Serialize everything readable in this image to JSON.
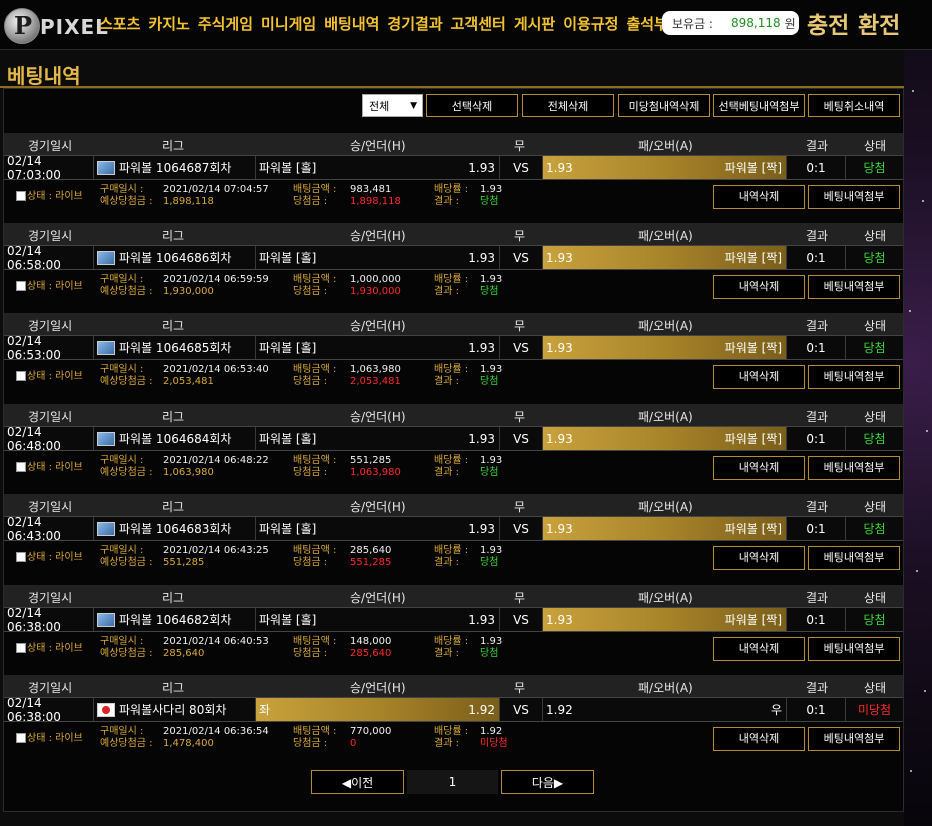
{
  "header": {
    "logo": "PIXEL",
    "logo_letter": "P",
    "nav": [
      "스포츠",
      "카지노",
      "주식게임",
      "미니게임",
      "배팅내역",
      "경기결과",
      "고객센터",
      "게시판",
      "이용규정",
      "출석부"
    ],
    "balance_label": "보유금 :",
    "balance_value": "898,118",
    "balance_unit": "원",
    "charge": "충전",
    "exchange": "환전"
  },
  "page_title": "베팅내역",
  "toolbar": {
    "filter_value": "전체",
    "buttons": [
      "선택삭제",
      "전체삭제",
      "미당첨내역삭제",
      "선택베팅내역첨부",
      "베팅취소내역"
    ]
  },
  "columns": {
    "date": "경기일시",
    "league": "리그",
    "home": "승/언더(H)",
    "draw": "무",
    "away": "패/오버(A)",
    "result": "결과",
    "status": "상태"
  },
  "labels": {
    "state": "상태 : 라이브",
    "purchase_time": "구매일시 :",
    "expected_win": "예상당첨금 :",
    "bet_amount": "배팅금액 :",
    "win_amount": "당첨금 :",
    "odds": "배당률 :",
    "result": "결과 :",
    "delete": "내역삭제",
    "attach": "베팅내역첨부",
    "vs": "VS"
  },
  "bets": [
    {
      "date": "02/14 07:03:00",
      "league": "파워볼 1064687회차",
      "home": "파워볼 [홀]",
      "home_odds": "1.93",
      "away_odds": "1.93",
      "away": "파워볼 [짝]",
      "score": "0:1",
      "status": "당첨",
      "purchase": "2021/02/14 07:04:57",
      "expected": "1,898,118",
      "amount": "983,481",
      "won": "1,898,118",
      "odds": "1.93",
      "result": "당첨"
    },
    {
      "date": "02/14 06:58:00",
      "league": "파워볼 1064686회차",
      "home": "파워볼 [홀]",
      "home_odds": "1.93",
      "away_odds": "1.93",
      "away": "파워볼 [짝]",
      "score": "0:1",
      "status": "당첨",
      "purchase": "2021/02/14 06:59:59",
      "expected": "1,930,000",
      "amount": "1,000,000",
      "won": "1,930,000",
      "odds": "1.93",
      "result": "당첨"
    },
    {
      "date": "02/14 06:53:00",
      "league": "파워볼 1064685회차",
      "home": "파워볼 [홀]",
      "home_odds": "1.93",
      "away_odds": "1.93",
      "away": "파워볼 [짝]",
      "score": "0:1",
      "status": "당첨",
      "purchase": "2021/02/14 06:53:40",
      "expected": "2,053,481",
      "amount": "1,063,980",
      "won": "2,053,481",
      "odds": "1.93",
      "result": "당첨"
    },
    {
      "date": "02/14 06:48:00",
      "league": "파워볼 1064684회차",
      "home": "파워볼 [홀]",
      "home_odds": "1.93",
      "away_odds": "1.93",
      "away": "파워볼 [짝]",
      "score": "0:1",
      "status": "당첨",
      "purchase": "2021/02/14 06:48:22",
      "expected": "1,063,980",
      "amount": "551,285",
      "won": "1,063,980",
      "odds": "1.93",
      "result": "당첨"
    },
    {
      "date": "02/14 06:43:00",
      "league": "파워볼 1064683회차",
      "home": "파워볼 [홀]",
      "home_odds": "1.93",
      "away_odds": "1.93",
      "away": "파워볼 [짝]",
      "score": "0:1",
      "status": "당첨",
      "purchase": "2021/02/14 06:43:25",
      "expected": "551,285",
      "amount": "285,640",
      "won": "551,285",
      "odds": "1.93",
      "result": "당첨"
    },
    {
      "date": "02/14 06:38:00",
      "league": "파워볼 1064682회차",
      "home": "파워볼 [홀]",
      "home_odds": "1.93",
      "away_odds": "1.93",
      "away": "파워볼 [짝]",
      "score": "0:1",
      "status": "당첨",
      "purchase": "2021/02/14 06:40:53",
      "expected": "285,640",
      "amount": "148,000",
      "won": "285,640",
      "odds": "1.93",
      "result": "당첨"
    },
    {
      "date": "02/14 06:38:00",
      "league": "파워볼사다리 80회차",
      "home": "좌",
      "home_odds": "1.92",
      "away_odds": "1.92",
      "away": "우",
      "score": "0:1",
      "status": "미당첨",
      "purchase": "2021/02/14 06:36:54",
      "expected": "1,478,400",
      "amount": "770,000",
      "won": "0",
      "odds": "1.92",
      "result": "미당첨"
    }
  ],
  "pager": {
    "prev": "◀이전",
    "page": "1",
    "next": "다음▶"
  },
  "colors": {
    "gold": "#c9a23c",
    "accent": "#f2c230",
    "win": "#3ad83a",
    "lose": "#ff2a2a"
  }
}
